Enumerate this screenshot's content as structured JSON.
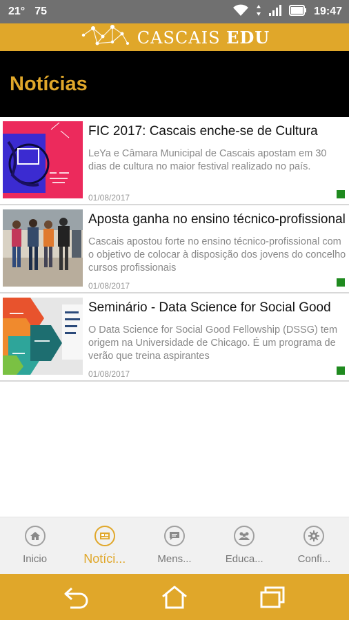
{
  "status_bar": {
    "temperature": "21°",
    "notification_count": "75",
    "time": "19:47"
  },
  "app": {
    "brand_name": "CASCAIS",
    "brand_suffix": "EDU",
    "accent_color": "#e0a72a"
  },
  "page": {
    "title": "Notícias"
  },
  "news": [
    {
      "title": "FIC 2017: Cascais enche-se de Cultura",
      "excerpt": "LeYa e Câmara Municipal de Cascais apostam em 30 dias de cultura no maior festival realizado no país.",
      "date": "01/08/2017",
      "thumb_icon": "fic-poster-thumbnail"
    },
    {
      "title": "Aposta ganha no ensino técnico-profissional",
      "excerpt": "Cascais apostou forte no ensino técnico-profissional com o objetivo de colocar à disposição dos jovens do concelho cursos profissionais",
      "date": "01/08/2017",
      "thumb_icon": "students-photo-thumbnail"
    },
    {
      "title": "Seminário - Data Science for Social Good",
      "excerpt": "O Data Science for Social Good Fellowship (DSSG) tem origem na Universidade de Chicago. É um programa de verão que treina aspirantes",
      "date": "01/08/2017",
      "thumb_icon": "data-science-thumbnail"
    }
  ],
  "tabs": [
    {
      "label": "Inicio",
      "icon": "home-icon"
    },
    {
      "label": "Notíci...",
      "icon": "news-icon",
      "active": true
    },
    {
      "label": "Mens...",
      "icon": "message-icon"
    },
    {
      "label": "Educa...",
      "icon": "people-icon"
    },
    {
      "label": "Confi...",
      "icon": "gear-icon"
    }
  ]
}
